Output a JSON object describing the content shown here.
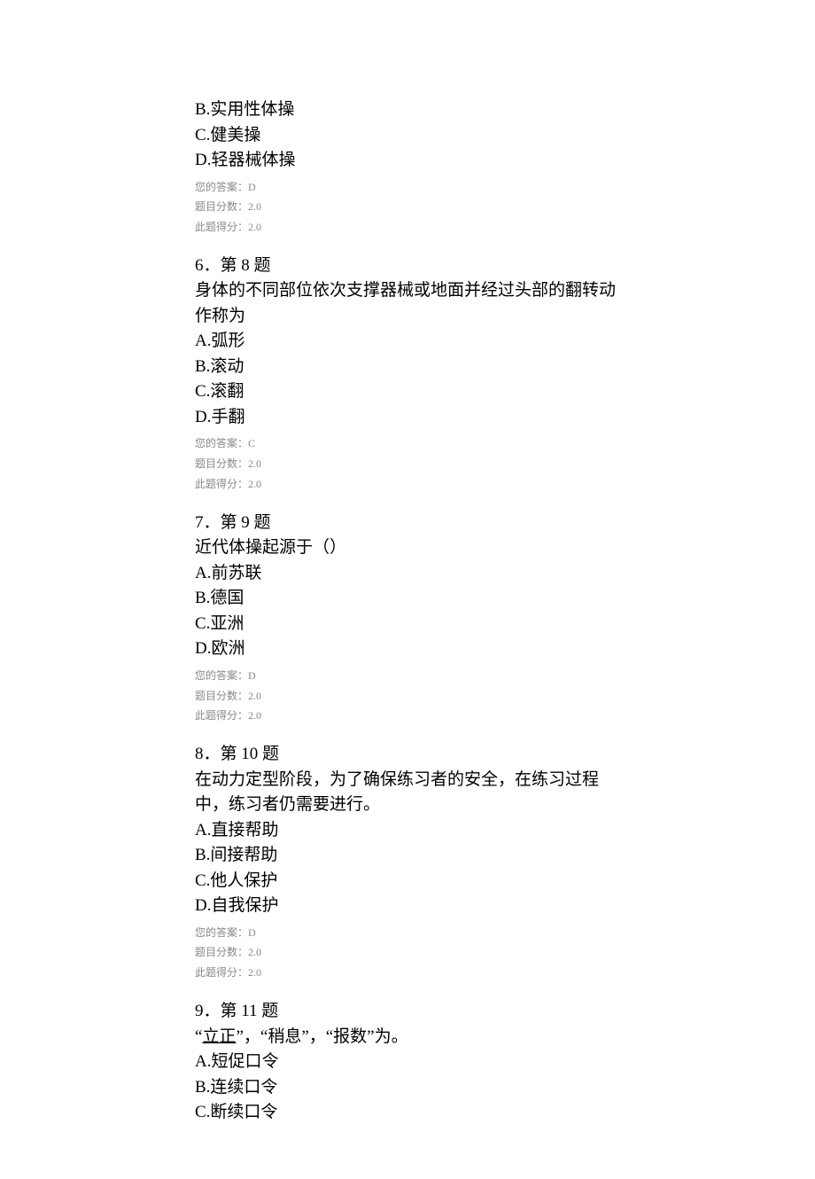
{
  "q5": {
    "options": {
      "B": "B.实用性体操",
      "C": "C.健美操",
      "D": "D.轻器械体操"
    },
    "meta": {
      "answer": "您的答案：D",
      "full": "题目分数：2.0",
      "got": "此题得分：2.0"
    }
  },
  "q6": {
    "header": "6．第 8 题",
    "stem": "身体的不同部位依次支撑器械或地面并经过头部的翻转动作称为",
    "options": {
      "A": "A.弧形",
      "B": "B.滚动",
      "C": "C.滚翻",
      "D": "D.手翻"
    },
    "meta": {
      "answer": "您的答案：C",
      "full": "题目分数：2.0",
      "got": "此题得分：2.0"
    }
  },
  "q7": {
    "header": "7．第 9 题",
    "stem": "近代体操起源于（）",
    "options": {
      "A": "A.前苏联",
      "B": "B.德国",
      "C": "C.亚洲",
      "D": "D.欧洲"
    },
    "meta": {
      "answer": "您的答案：D",
      "full": "题目分数：2.0",
      "got": "此题得分：2.0"
    }
  },
  "q8": {
    "header": "8．第 10 题",
    "stem": "在动力定型阶段，为了确保练习者的安全，在练习过程中，练习者仍需要进行。",
    "options": {
      "A": "A.直接帮助",
      "B": "B.间接帮助",
      "C": "C.他人保护",
      "D": "D.自我保护"
    },
    "meta": {
      "answer": "您的答案：D",
      "full": "题目分数：2.0",
      "got": "此题得分：2.0"
    }
  },
  "q9": {
    "header": "9．第 11 题",
    "stem_pre": "“",
    "stem_underlined": "立正",
    "stem_post": "”，“稍息”，“报数”为。",
    "options": {
      "A": "A.短促口令",
      "B": "B.连续口令",
      "C": "C.断续口令"
    }
  }
}
